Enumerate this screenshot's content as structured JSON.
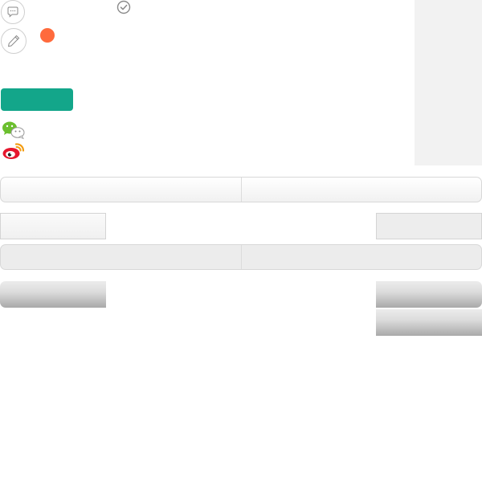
{
  "icons": {
    "comment": "speech-bubble-icon",
    "edit": "pencil-icon",
    "check": "check-circle-icon",
    "wechat": "wechat-icon",
    "weibo": "weibo-icon"
  },
  "colors": {
    "accent_green": "#13a68a",
    "notification_dot": "#ff6a3c",
    "side_panel": "#f2f2f2",
    "icon_gray": "#8a8a8a"
  },
  "primary_button": {
    "label": ""
  }
}
